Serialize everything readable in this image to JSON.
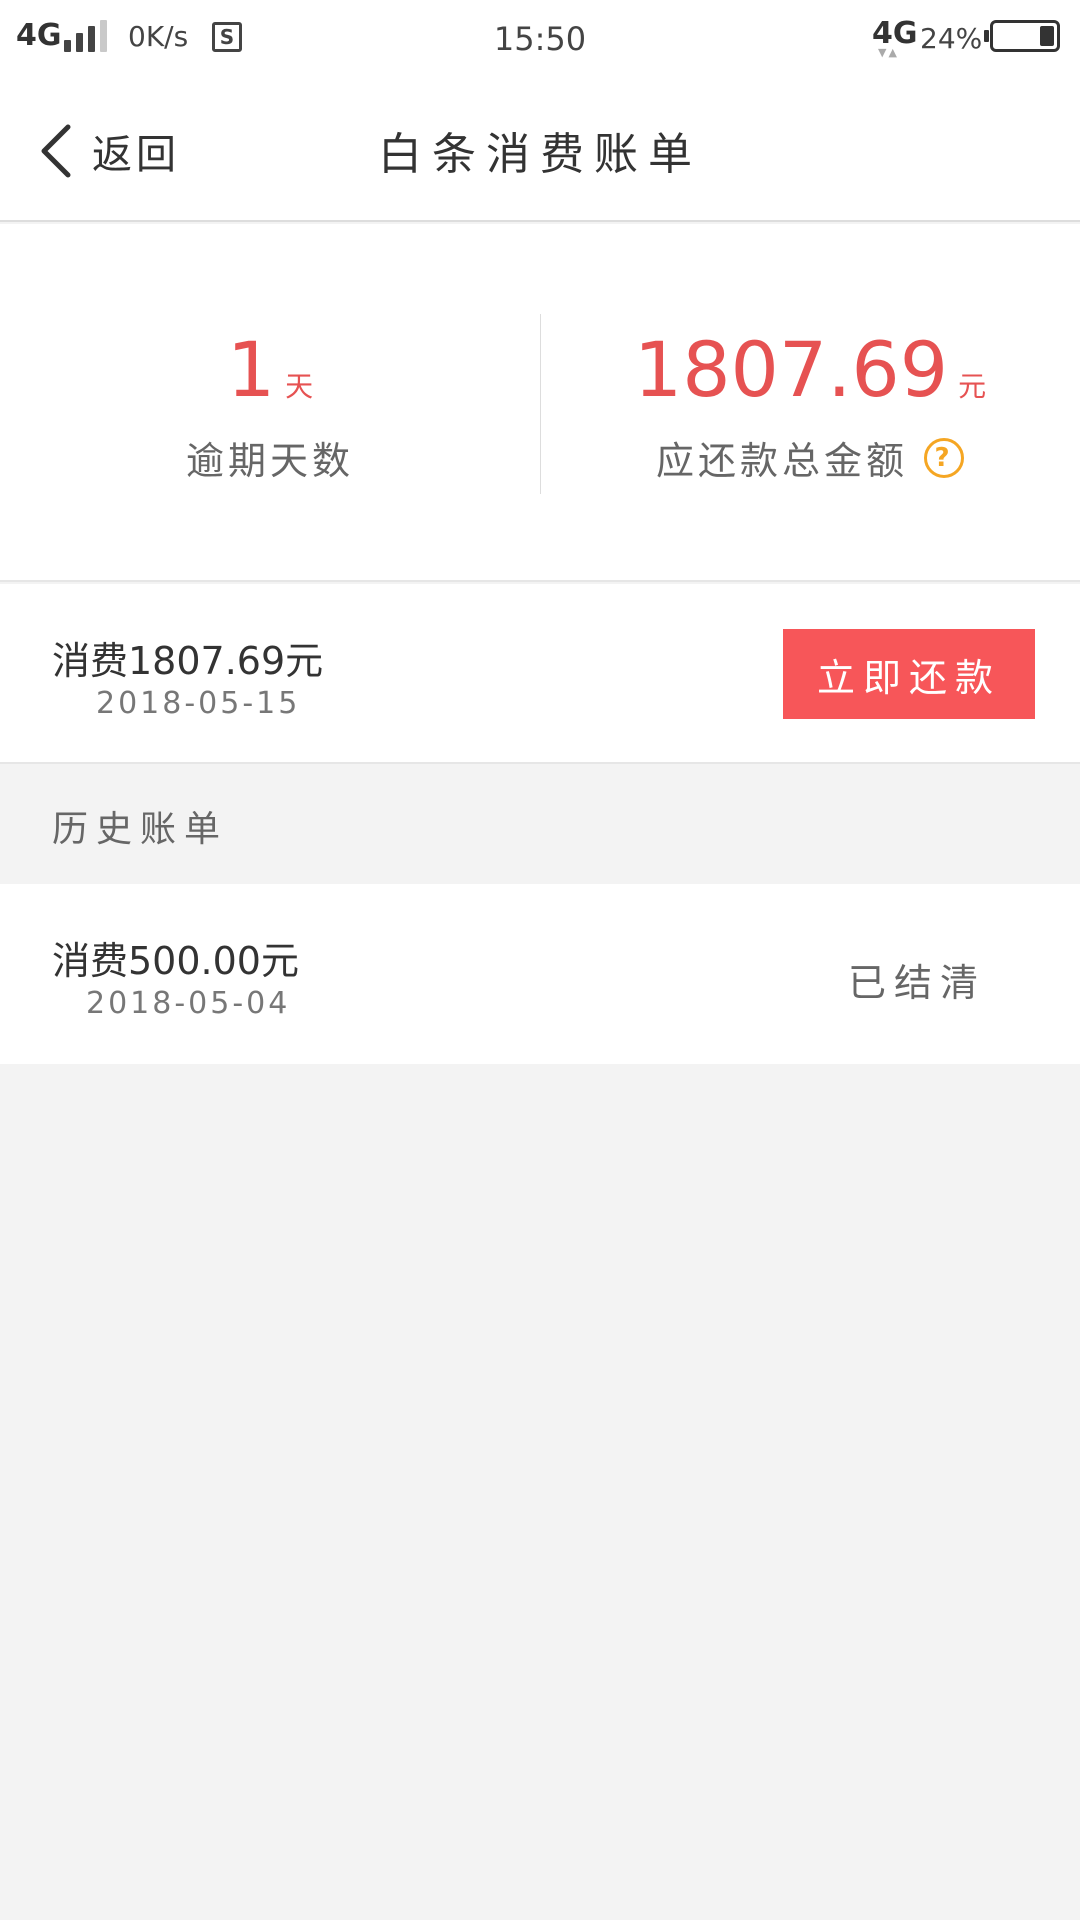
{
  "status_bar": {
    "network_left": "4G",
    "speed": "0K/s",
    "s_icon": "S",
    "time": "15:50",
    "network_right": "4G",
    "battery_percent": "24%",
    "battery_level": 0.24
  },
  "header": {
    "back_label": "返回",
    "title": "白条消费账单"
  },
  "summary": {
    "overdue_days": "1",
    "overdue_unit": "天",
    "overdue_label": "逾期天数",
    "total_amount": "1807.69",
    "total_unit": "元",
    "total_label": "应还款总金额",
    "help_icon": "?"
  },
  "current_bill": {
    "amount_text": "消费1807.69元",
    "date": "2018-05-15",
    "repay_label": "立即还款"
  },
  "history": {
    "heading": "历史账单",
    "items": [
      {
        "amount_text": "消费500.00元",
        "date": "2018-05-04",
        "status": "已结清"
      }
    ]
  },
  "colors": {
    "accent_red": "#f75659",
    "amount_red": "#e65252",
    "help_orange": "#f5a623",
    "page_bg": "#f3f3f3"
  }
}
